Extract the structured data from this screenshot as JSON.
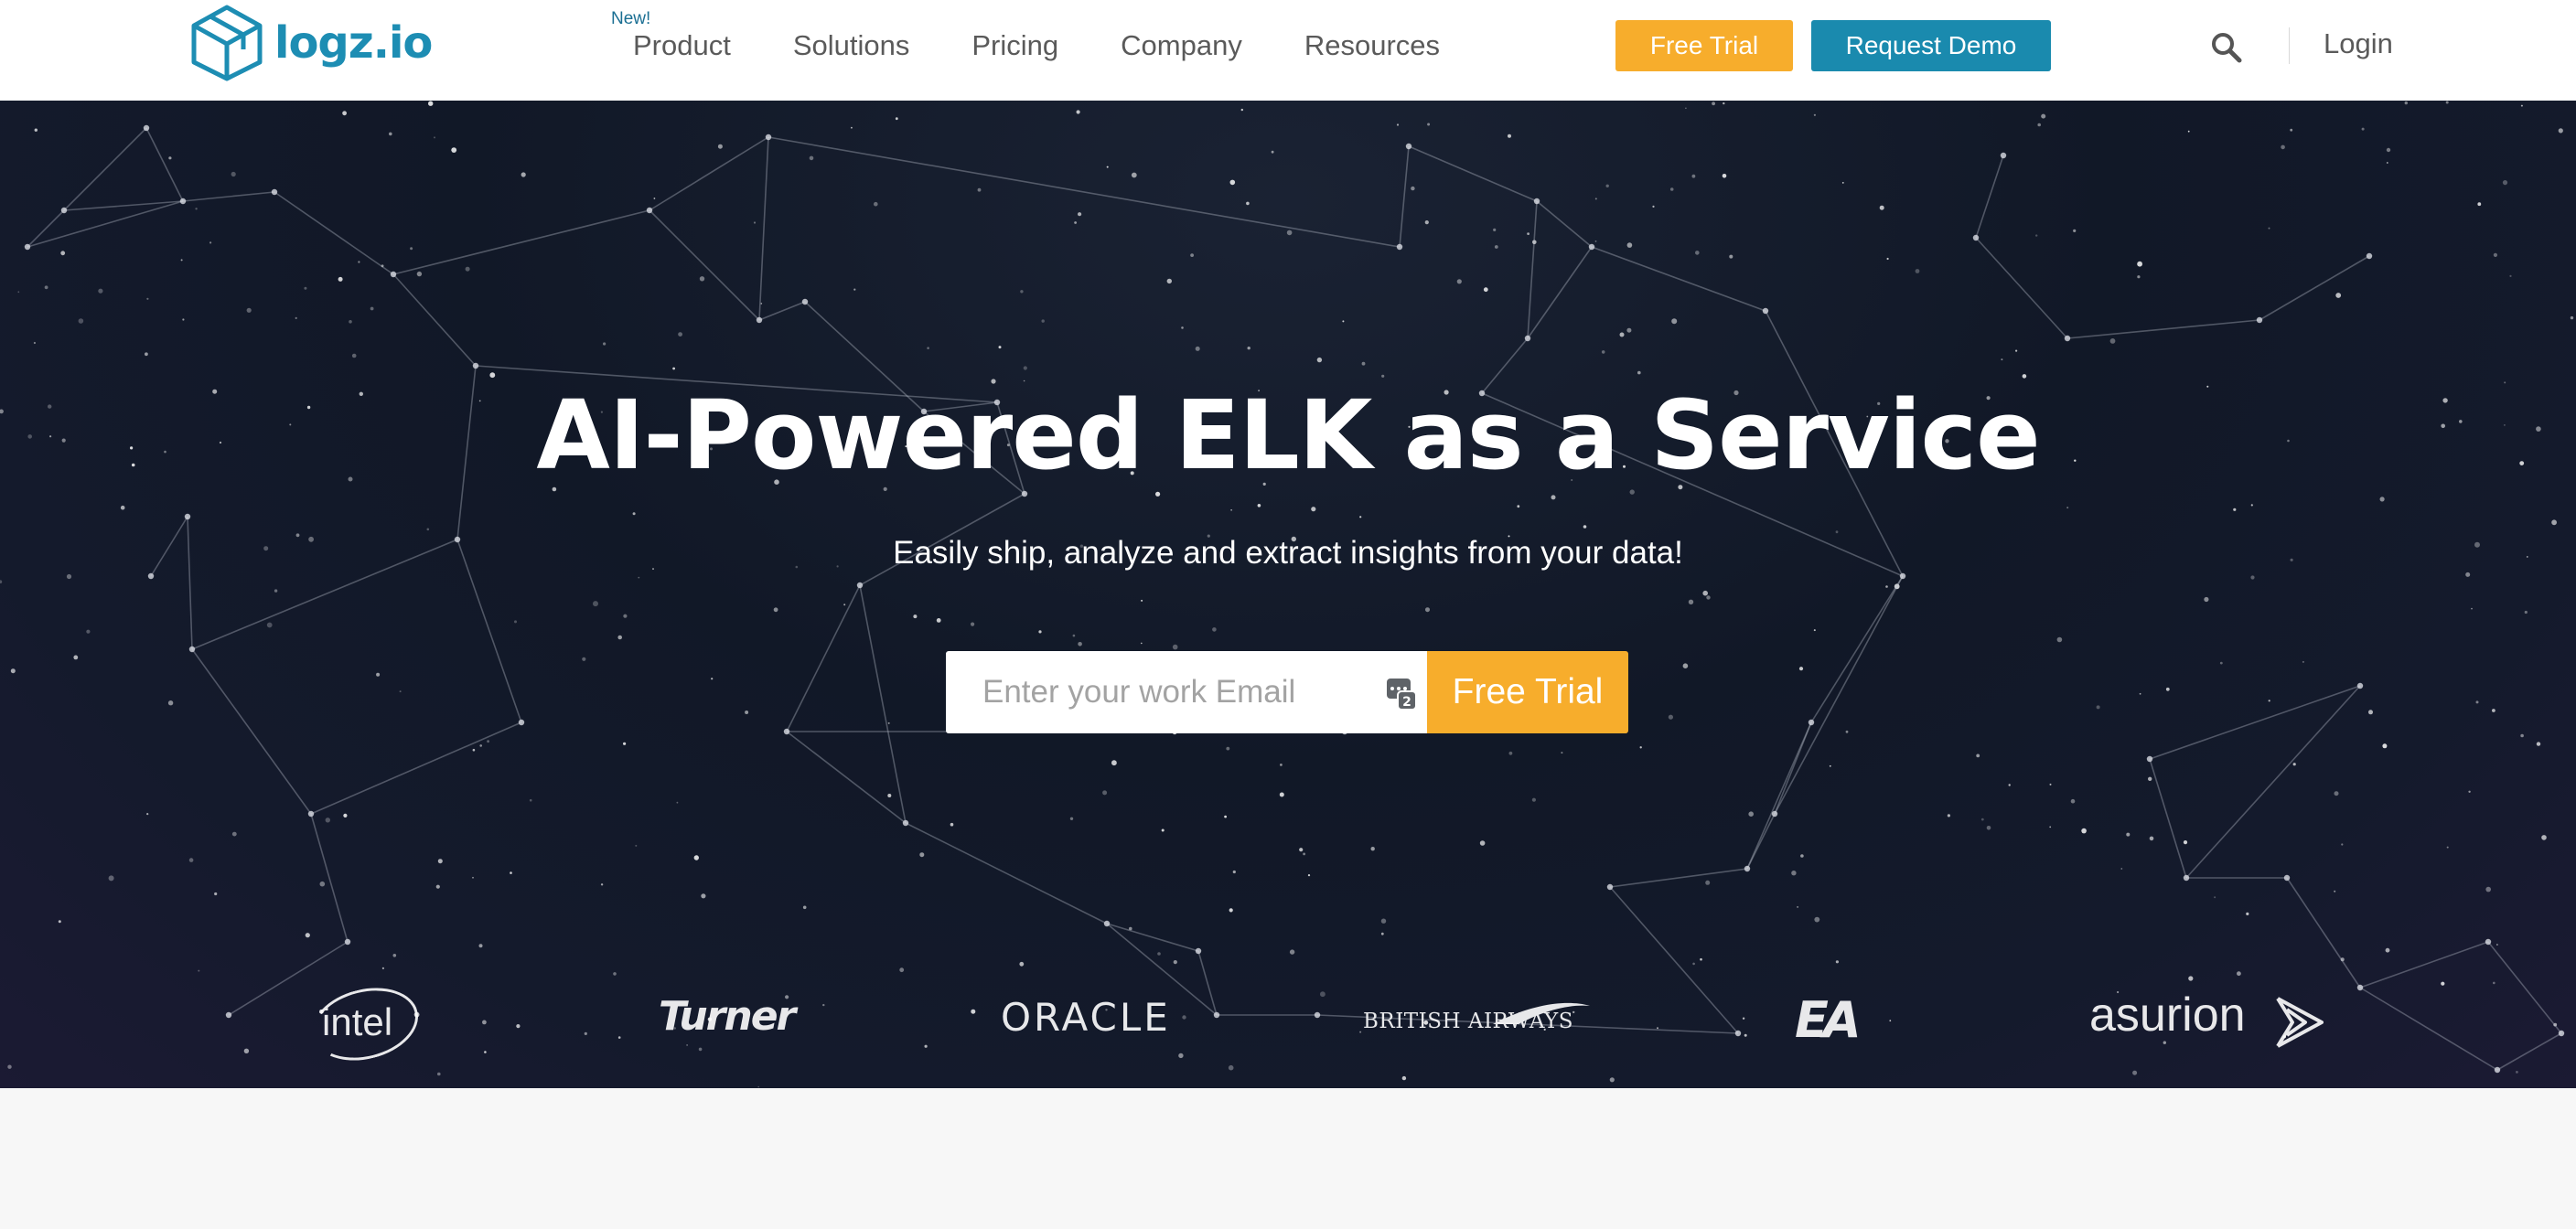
{
  "header": {
    "logo_text": "logz.io",
    "nav": [
      {
        "label": "Product",
        "badge": "New!"
      },
      {
        "label": "Solutions"
      },
      {
        "label": "Pricing"
      },
      {
        "label": "Company"
      },
      {
        "label": "Resources"
      }
    ],
    "free_trial_label": "Free Trial",
    "request_demo_label": "Request Demo",
    "search_icon": "search-icon",
    "login_label": "Login"
  },
  "hero": {
    "title": "AI-Powered ELK as a Service",
    "subtitle": "Easily ship, analyze and extract insights from your data!",
    "email_placeholder": "Enter your work Email",
    "email_value": "",
    "cta_label": "Free Trial",
    "autofill_icon": "password-manager-icon"
  },
  "clients": {
    "intel": "intel",
    "turner": "Turner",
    "oracle": "ORACLE",
    "british_airways": "BRITISH AIRWAYS",
    "ea": "EA",
    "asurion": "asurion"
  },
  "colors": {
    "brand_blue": "#1a8aae",
    "accent_orange": "#f7ad2c",
    "hero_bg": "#111827",
    "nav_text": "#5a5a5a"
  }
}
